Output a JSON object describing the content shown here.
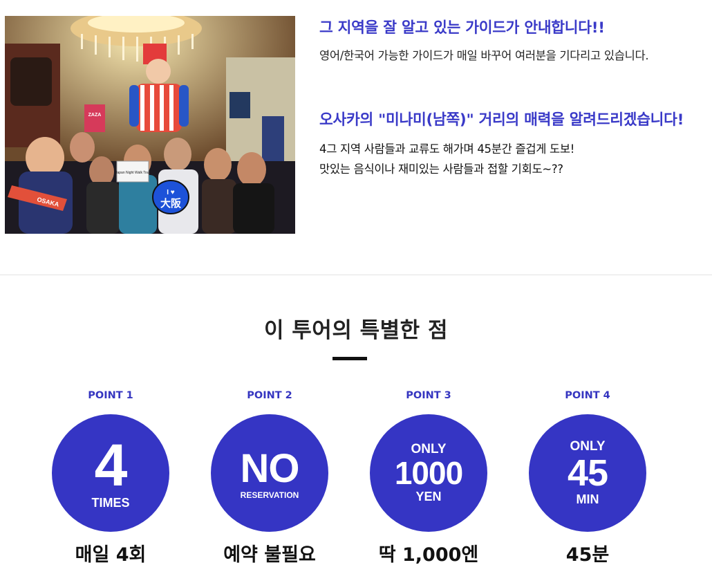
{
  "intro": {
    "heading1": "그 지역을 잘 알고 있는 가이드가 안내합니다!!",
    "para1": "영어/한국어 가능한 가이드가 매일 바꾸어 여러분을 기다리고 있습니다.",
    "heading2": "오사카의 \"미나미(남쪽)\" 거리의 매력을 알려드리겠습니다!",
    "para2_line1": "4그 지역 사람들과 교류도 해가며 45분간 즐겁게 도보!",
    "para2_line2": "맛있는 음식이나 재미있는 사람들과 접할 기회도~??"
  },
  "photo_sign": {
    "text1": "ZAZA",
    "text2": "OSAKA",
    "text3": "I ♥",
    "text4": "大阪",
    "text5": "Japan Night Walk Tour"
  },
  "features": {
    "title": "이 투어의 특별한 점",
    "points": [
      {
        "label": "POINT 1",
        "top": "",
        "big": "4",
        "bottom": "TIMES",
        "caption": "매일 4회"
      },
      {
        "label": "POINT 2",
        "top": "",
        "big": "NO",
        "bottom": "RESERVATION",
        "caption": "예약 불필요"
      },
      {
        "label": "POINT 3",
        "top": "ONLY",
        "big": "1000",
        "bottom": "YEN",
        "caption": "딱 1,000엔"
      },
      {
        "label": "POINT 4",
        "top": "ONLY",
        "big": "45",
        "bottom": "MIN",
        "caption": "45분"
      }
    ]
  },
  "colors": {
    "accent": "#3535c4",
    "heading": "#3a3ac8"
  }
}
